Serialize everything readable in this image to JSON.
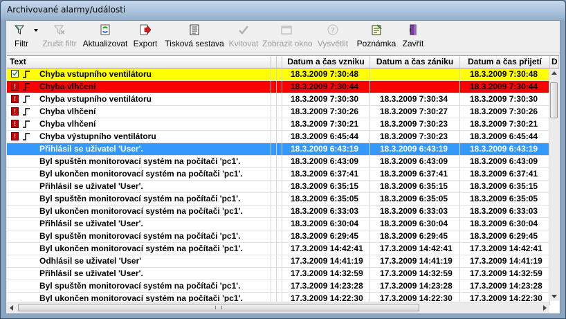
{
  "window": {
    "title": "Archivované alarmy/události"
  },
  "toolbar": {
    "filter": "Filtr",
    "clear_filter": "Zrušit filtr",
    "refresh": "Aktualizovat",
    "export": "Export",
    "print_report": "Tisková sestava",
    "acknowledge": "Kvitovat",
    "show_window": "Zobrazit okno",
    "explain": "Vysvětlit",
    "note": "Poznámka",
    "close": "Zavřít"
  },
  "table": {
    "columns": [
      "Text",
      "Datum a čas vzniku",
      "Datum a čas zániku",
      "Datum a čas přijetí",
      "D"
    ],
    "rows": [
      {
        "text": "Chyba vstupního ventilátoru",
        "created": "18.3.2009 7:30:48",
        "ended": "",
        "accepted": "18.3.2009 7:30:48",
        "style": "yellow",
        "icon": "ack"
      },
      {
        "text": "Chyba vlhčení",
        "created": "18.3.2009 7:30:44",
        "ended": "",
        "accepted": "18.3.2009 7:30:44",
        "style": "red",
        "icon": "alarm"
      },
      {
        "text": "Chyba vstupního ventilátoru",
        "created": "18.3.2009 7:30:30",
        "ended": "18.3.2009 7:30:34",
        "accepted": "18.3.2009 7:30:30",
        "style": "",
        "icon": "alarm"
      },
      {
        "text": "Chyba vlhčení",
        "created": "18.3.2009 7:30:26",
        "ended": "18.3.2009 7:30:27",
        "accepted": "18.3.2009 7:30:26",
        "style": "",
        "icon": "alarm"
      },
      {
        "text": "Chyba vlhčení",
        "created": "18.3.2009 7:30:21",
        "ended": "18.3.2009 7:30:23",
        "accepted": "18.3.2009 7:30:21",
        "style": "",
        "icon": "alarm"
      },
      {
        "text": "Chyba výstupního ventilátoru",
        "created": "18.3.2009 6:45:44",
        "ended": "18.3.2009 7:30:23",
        "accepted": "18.3.2009 6:45:44",
        "style": "",
        "icon": "alarm"
      },
      {
        "text": "Přihlásil se uživatel 'User'.",
        "created": "18.3.2009 6:43:19",
        "ended": "18.3.2009 6:43:19",
        "accepted": "18.3.2009 6:43:19",
        "style": "sel",
        "icon": ""
      },
      {
        "text": "Byl spuštěn monitorovací systém na počítači 'pc1'.",
        "created": "18.3.2009 6:43:09",
        "ended": "18.3.2009 6:43:09",
        "accepted": "18.3.2009 6:43:09",
        "style": "",
        "icon": ""
      },
      {
        "text": "Byl ukončen monitorovací systém na počítači 'pc1'.",
        "created": "18.3.2009 6:37:41",
        "ended": "18.3.2009 6:37:41",
        "accepted": "18.3.2009 6:37:41",
        "style": "",
        "icon": ""
      },
      {
        "text": "Přihlásil se uživatel 'User'.",
        "created": "18.3.2009 6:35:15",
        "ended": "18.3.2009 6:35:15",
        "accepted": "18.3.2009 6:35:15",
        "style": "",
        "icon": ""
      },
      {
        "text": "Byl spuštěn monitorovací systém na počítači 'pc1'.",
        "created": "18.3.2009 6:35:05",
        "ended": "18.3.2009 6:35:05",
        "accepted": "18.3.2009 6:35:05",
        "style": "",
        "icon": ""
      },
      {
        "text": "Byl ukončen monitorovací systém na počítači 'pc1'.",
        "created": "18.3.2009 6:33:03",
        "ended": "18.3.2009 6:33:03",
        "accepted": "18.3.2009 6:33:03",
        "style": "",
        "icon": ""
      },
      {
        "text": "Přihlásil se uživatel 'User'.",
        "created": "18.3.2009 6:30:04",
        "ended": "18.3.2009 6:30:04",
        "accepted": "18.3.2009 6:30:04",
        "style": "",
        "icon": ""
      },
      {
        "text": "Byl spuštěn monitorovací systém na počítači 'pc1'.",
        "created": "18.3.2009 6:29:45",
        "ended": "18.3.2009 6:29:45",
        "accepted": "18.3.2009 6:29:45",
        "style": "",
        "icon": ""
      },
      {
        "text": "Byl ukončen monitorovací systém na počítači 'pc1'.",
        "created": "17.3.2009 14:42:41",
        "ended": "17.3.2009 14:42:41",
        "accepted": "17.3.2009 14:42:41",
        "style": "",
        "icon": ""
      },
      {
        "text": "Odhlásil se uživatel 'User'",
        "created": "17.3.2009 14:41:19",
        "ended": "17.3.2009 14:41:19",
        "accepted": "17.3.2009 14:41:19",
        "style": "",
        "icon": ""
      },
      {
        "text": "Přihlásil se uživatel 'User'.",
        "created": "17.3.2009 14:32:59",
        "ended": "17.3.2009 14:32:59",
        "accepted": "17.3.2009 14:32:59",
        "style": "",
        "icon": ""
      },
      {
        "text": "Byl spuštěn monitorovací systém na počítači 'pc1'.",
        "created": "17.3.2009 14:23:28",
        "ended": "17.3.2009 14:23:28",
        "accepted": "17.3.2009 14:23:28",
        "style": "",
        "icon": ""
      },
      {
        "text": "Byl ukončen monitorovací systém na počítači 'pc1'.",
        "created": "17.3.2009 14:22:30",
        "ended": "17.3.2009 14:22:30",
        "accepted": "17.3.2009 14:22:30",
        "style": "",
        "icon": ""
      }
    ]
  },
  "colors": {
    "alarm_active_unacked": "#ffff00",
    "alarm_active": "#ff0000",
    "selection": "#3399ff"
  }
}
